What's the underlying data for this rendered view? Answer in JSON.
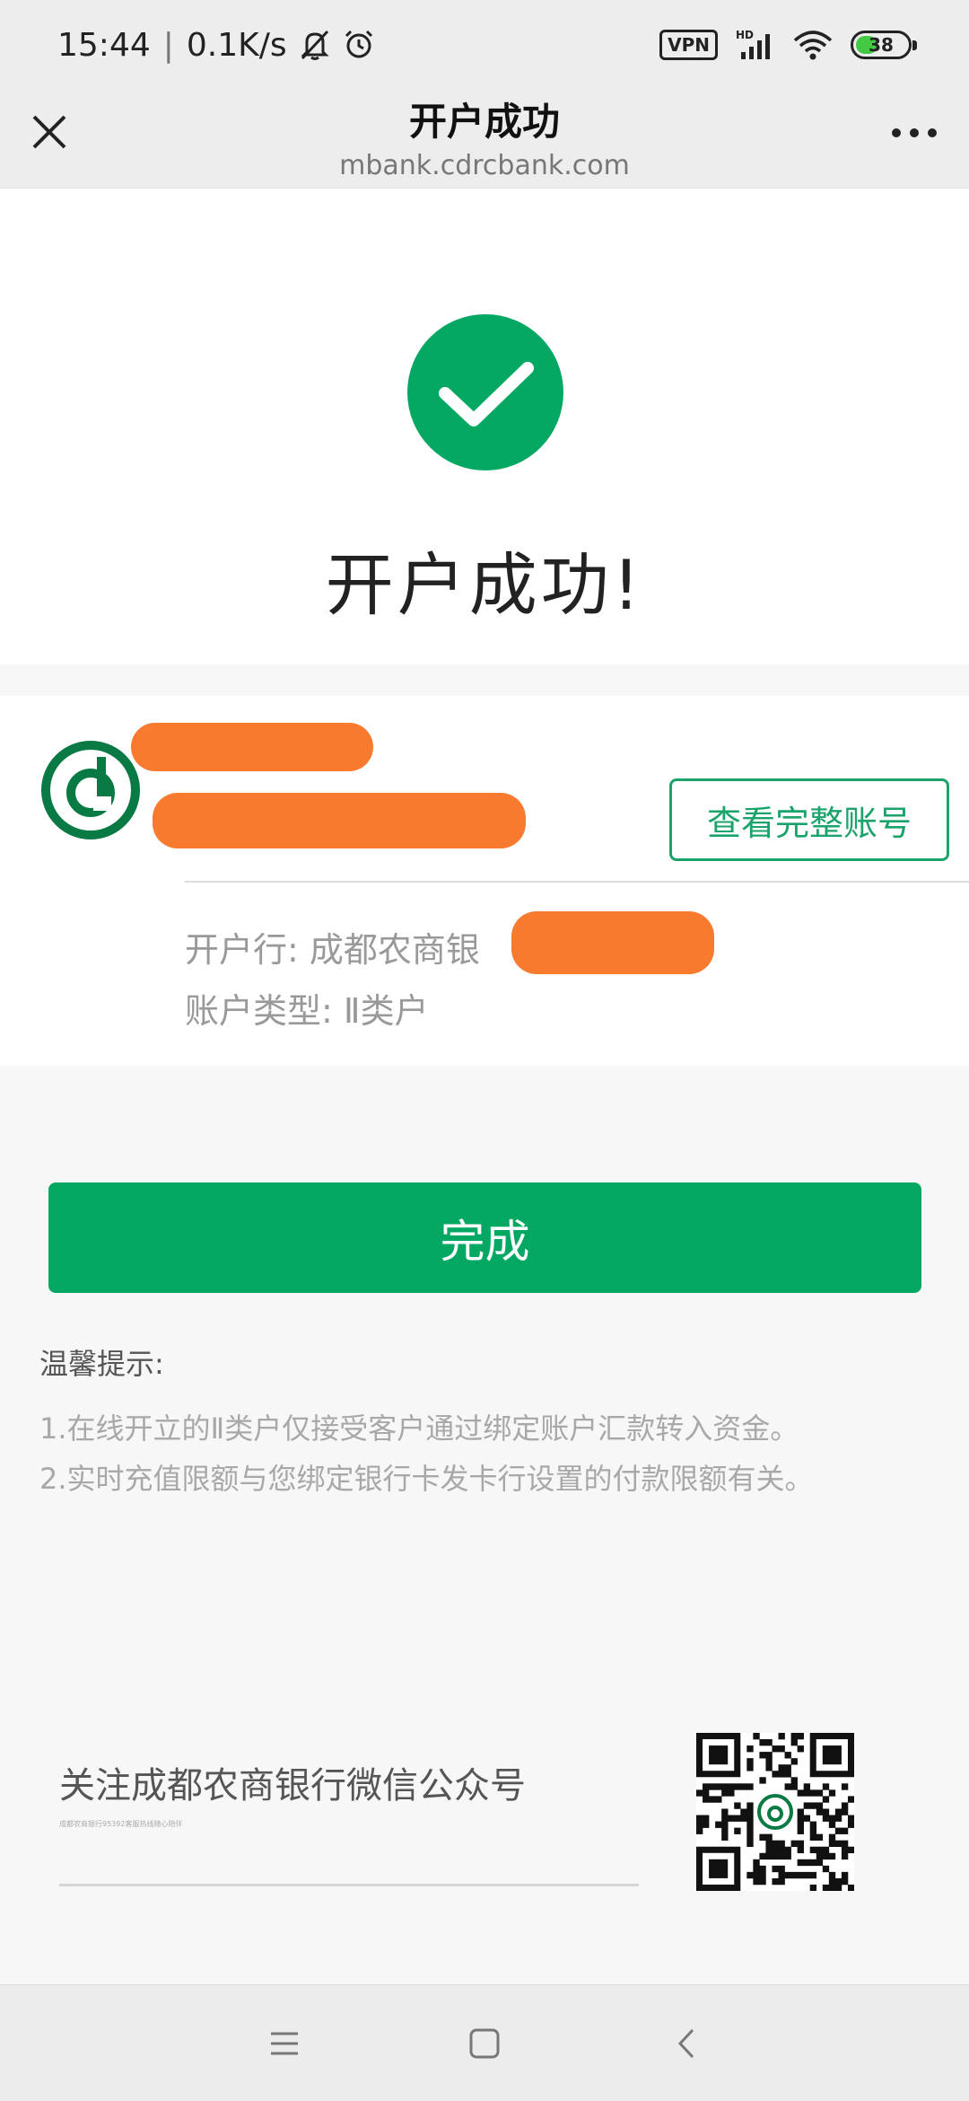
{
  "status_bar": {
    "time": "15:44",
    "separator": "|",
    "net_speed": "0.1K/s",
    "vpn": "VPN",
    "signal_tag": "HD",
    "battery": "38",
    "battery_level": 0.38
  },
  "title_bar": {
    "title": "开户成功",
    "url": "mbank.cdrcbank.com"
  },
  "success": {
    "message": "开户成功!"
  },
  "account": {
    "view_button": "查看完整账号",
    "bank_label": "开户行:",
    "bank_value": "成都农商银",
    "type_label": "账户类型:",
    "type_value": "Ⅱ类户"
  },
  "done_button": "完成",
  "tips": {
    "title": "温馨提示:",
    "lines": [
      "1.在线开立的Ⅱ类户仅接受客户通过绑定账户汇款转入资金。",
      "2.实时充值限额与您绑定银行卡发卡行设置的付款限额有关。"
    ]
  },
  "follow": {
    "title": "关注成都农商银行微信公众号",
    "subtitle": "成都农商银行95392客服热线随心陪伴"
  },
  "colors": {
    "brand_green": "#05a862",
    "outline_green": "#1aa36a",
    "logo_green": "#0a7a45",
    "redaction": "#f77a2f"
  },
  "icons": {
    "close": "close-icon",
    "more": "more-dots-icon",
    "check": "check-circle-icon",
    "logo": "bank-logo-icon",
    "qr": "qr-code-icon",
    "nav_menu": "menu-icon",
    "nav_home": "home-square-icon",
    "nav_back": "back-chevron-icon"
  }
}
